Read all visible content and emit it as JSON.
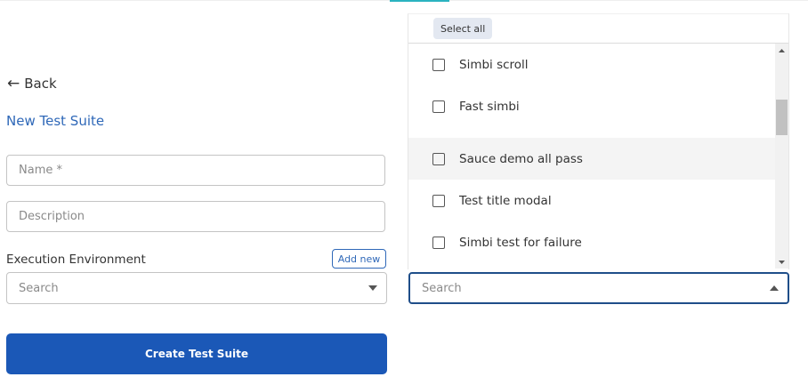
{
  "back": {
    "label": "Back"
  },
  "page_title": "New Test Suite",
  "form": {
    "name_placeholder": "Name *",
    "name_value": "",
    "description_placeholder": "Description",
    "description_value": "",
    "execution_environment": {
      "label": "Execution Environment",
      "add_new_label": "Add new",
      "search_placeholder": "Search"
    },
    "create_button_label": "Create Test Suite"
  },
  "test_picker": {
    "select_all_label": "Select all",
    "search_placeholder": "Search",
    "options": [
      {
        "label": "Simbi scroll",
        "checked": false
      },
      {
        "label": "Fast simbi",
        "checked": false
      },
      {
        "label": "Sauce demo all pass",
        "checked": false,
        "hovered": true
      },
      {
        "label": "Test title modal",
        "checked": false
      },
      {
        "label": "Simbi test for failure",
        "checked": false
      }
    ]
  },
  "colors": {
    "accent": "#1b58b7",
    "title": "#2f68b8",
    "focus_border": "#1f4e89",
    "tab_indicator": "#2ab3c0"
  },
  "icons": {
    "back": "arrow-left-icon",
    "env_caret": "caret-down-icon",
    "test_caret": "caret-up-icon"
  }
}
